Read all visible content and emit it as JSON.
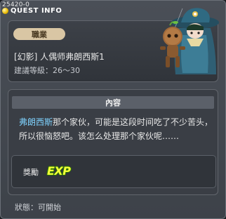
{
  "window": {
    "quest_id": "25420-0",
    "title": "QUEST INFO"
  },
  "header": {
    "job_badge": "職業",
    "quest_name": "[幻影] 人偶师弗朗西斯1",
    "recommend_level": "建議等級：26～30",
    "npc_icon": "francis-puppeteer-npc-icon"
  },
  "content": {
    "section_title": "內容",
    "npc_name": "弗朗西斯",
    "description_rest": "那个家伙，可能是这段时间吃了不少苦头，所以很恼怒吧。该怎么处理那个家伙呢……"
  },
  "reward": {
    "label": "獎勵",
    "exp_icon_text": "EXP"
  },
  "status": {
    "text": "狀態：可開始"
  },
  "colors": {
    "npc_name": "#7fd3ff",
    "job_badge_bg": "#d9c6a4",
    "exp_fill": "#f5ff3a",
    "exp_outline": "#2e7d00"
  }
}
